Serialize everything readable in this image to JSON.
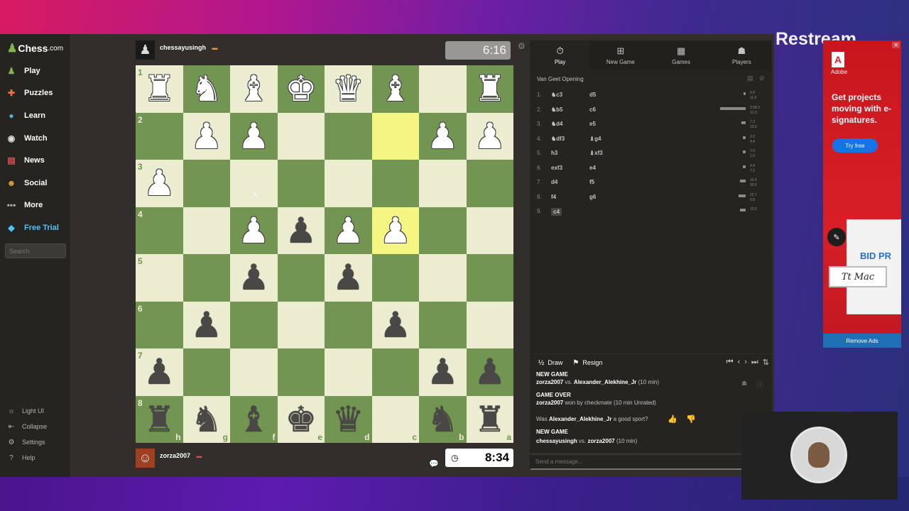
{
  "sidebar": {
    "logo_text": "Chess",
    "logo_suffix": ".com",
    "items": [
      {
        "label": "Play",
        "icon": "play-icon"
      },
      {
        "label": "Puzzles",
        "icon": "puzzle-icon"
      },
      {
        "label": "Learn",
        "icon": "learn-icon"
      },
      {
        "label": "Watch",
        "icon": "watch-icon"
      },
      {
        "label": "News",
        "icon": "news-icon"
      },
      {
        "label": "Social",
        "icon": "social-icon"
      },
      {
        "label": "More",
        "icon": "more-icon"
      },
      {
        "label": "Free Trial",
        "icon": "diamond-icon"
      }
    ],
    "search_placeholder": "Search",
    "bottom": [
      "Light UI",
      "Collapse",
      "Settings",
      "Help"
    ]
  },
  "top_player": {
    "name": "chessayusingh",
    "clock": "6:16"
  },
  "bottom_player": {
    "name": "zorza2007",
    "clock": "8:34"
  },
  "board": {
    "orientation": "black",
    "rank_labels": [
      "1",
      "2",
      "3",
      "4",
      "5",
      "6",
      "7",
      "8"
    ],
    "file_labels": [
      "h",
      "g",
      "f",
      "e",
      "d",
      "c",
      "b",
      "a"
    ],
    "rows": [
      [
        "wR",
        "wN",
        "wB",
        "wK",
        "wQ",
        "wB",
        "",
        "wR"
      ],
      [
        "",
        "wP",
        "wP",
        "",
        "",
        "",
        "wP",
        "wP"
      ],
      [
        "wP",
        "",
        "",
        "",
        "",
        "",
        "",
        ""
      ],
      [
        "",
        "",
        "wP",
        "bP",
        "wP",
        "wP",
        "",
        ""
      ],
      [
        "",
        "",
        "bP",
        "",
        "bP",
        "",
        "",
        ""
      ],
      [
        "",
        "bP",
        "",
        "",
        "",
        "bP",
        "",
        ""
      ],
      [
        "bP",
        "",
        "",
        "",
        "",
        "",
        "bP",
        "bP"
      ],
      [
        "bR",
        "bN",
        "bB",
        "bK",
        "bQ",
        "",
        "bN",
        "bR"
      ]
    ],
    "highlights": [
      "r1c5",
      "r3c5"
    ],
    "colors": {
      "light": "#ebecd0",
      "dark": "#739552",
      "highlight": "#f5f682"
    }
  },
  "panel": {
    "tabs": [
      {
        "label": "Play",
        "icon": "stopwatch-icon"
      },
      {
        "label": "New Game",
        "icon": "plus-icon"
      },
      {
        "label": "Games",
        "icon": "games-grid-icon"
      },
      {
        "label": "Players",
        "icon": "players-icon"
      }
    ],
    "opening": "Van Geet Opening",
    "moves": [
      {
        "n": "1.",
        "w": "♞c3",
        "b": "d5",
        "t1": "0.9",
        "t2": "11.0"
      },
      {
        "n": "2.",
        "w": "♞b5",
        "b": "c6",
        "t1": "2:38.3",
        "t2": "13.3"
      },
      {
        "n": "3.",
        "w": "♞d4",
        "b": "e5",
        "t1": "7.3",
        "t2": "15.0"
      },
      {
        "n": "4.",
        "w": "♞df3",
        "b": "♝g4",
        "t1": "3.3",
        "t2": "4.4"
      },
      {
        "n": "5.",
        "w": "h3",
        "b": "♝xf3",
        "t1": "7.0",
        "t2": "1.5"
      },
      {
        "n": "6.",
        "w": "exf3",
        "b": "e4",
        "t1": "4.4",
        "t2": "7.2"
      },
      {
        "n": "7.",
        "w": "d4",
        "b": "f5",
        "t1": "10.4",
        "t2": "30.5"
      },
      {
        "n": "8.",
        "w": "f4",
        "b": "g6",
        "t1": "15.7",
        "t2": "0.9"
      },
      {
        "n": "9.",
        "w": "c4",
        "b": "",
        "t1": "15.5",
        "t2": ""
      }
    ],
    "draw_label": "Draw",
    "resign_label": "Resign"
  },
  "chat": {
    "new_game_1": "NEW GAME",
    "match_1_a": "zorza2007",
    "match_1_vs": " vs. ",
    "match_1_b": "Alexander_Alekhine_Jr",
    "match_1_t": " (10 min)",
    "game_over": "GAME OVER",
    "result_player": "zorza2007",
    "result_text": " won by checkmate (10 min Unrated)",
    "question_pre": "Was ",
    "question_name": "Alexander_Alekhine_Jr",
    "question_post": " a good sport?",
    "new_game_2": "NEW GAME",
    "match_2_a": "chessayusingh",
    "match_2_vs": " vs. ",
    "match_2_b": "zorza2007",
    "match_2_t": " (10 min)",
    "send_placeholder": "Send a message..."
  },
  "overlay": {
    "restream": "Restream"
  },
  "ad": {
    "brand": "Adobe",
    "headline": "Get projects moving with e-signatures.",
    "cta": "Try free",
    "doc_text": "BID PR",
    "remove": "Remove Ads"
  }
}
